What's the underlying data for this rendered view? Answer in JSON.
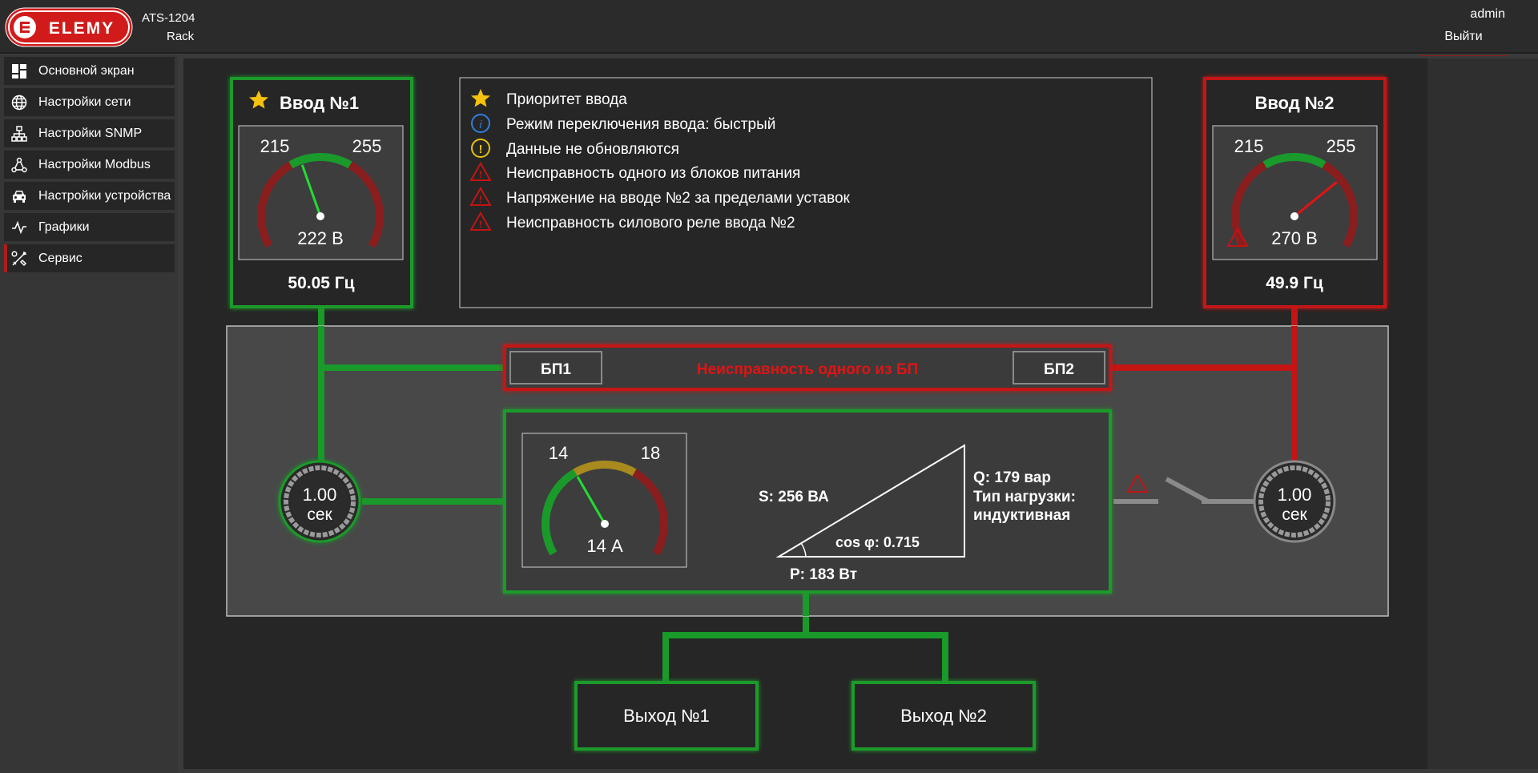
{
  "header": {
    "logo_text": "ELEMY",
    "device_model": "ATS-1204",
    "device_type": "Rack",
    "user": "admin",
    "logout_label": "Выйти"
  },
  "sidebar": {
    "items": [
      {
        "label": "Основной экран",
        "icon": "dashboard-icon",
        "active": false
      },
      {
        "label": "Настройки сети",
        "icon": "globe-icon",
        "active": false
      },
      {
        "label": "Настройки SNMP",
        "icon": "network-tree-icon",
        "active": false
      },
      {
        "label": "Настройки Modbus",
        "icon": "nodes-icon",
        "active": false
      },
      {
        "label": "Настройки устройства",
        "icon": "car-icon",
        "active": false
      },
      {
        "label": "Графики",
        "icon": "pulse-icon",
        "active": false
      },
      {
        "label": "Сервис",
        "icon": "tools-icon",
        "active": true
      }
    ]
  },
  "input1": {
    "title": "Ввод №1",
    "priority": true,
    "gauge_min_label": "215",
    "gauge_max_label": "255",
    "voltage": "222 В",
    "voltage_value": 222,
    "frequency": "50.05 Гц",
    "status_color": "#1a9a2a"
  },
  "input2": {
    "title": "Ввод №2",
    "gauge_min_label": "215",
    "gauge_max_label": "255",
    "voltage": "270 В",
    "voltage_value": 270,
    "frequency": "49.9 Гц",
    "status_color": "#c41414",
    "warning": true
  },
  "events": [
    {
      "icon": "star-icon",
      "text": "Приоритет ввода"
    },
    {
      "icon": "info-icon",
      "text": "Режим переключения ввода: быстрый"
    },
    {
      "icon": "exclamation-circle-icon",
      "text": "Данные не обновляются"
    },
    {
      "icon": "warning-triangle-icon",
      "text": "Неисправность одного из блоков питания"
    },
    {
      "icon": "warning-triangle-icon",
      "text": "Напряжение на вводе №2 за пределами уставок"
    },
    {
      "icon": "warning-triangle-icon",
      "text": "Неисправность силового реле ввода №2"
    }
  ],
  "power_supply": {
    "bp1_label": "БП1",
    "bp2_label": "БП2",
    "fault_text": "Неисправность одного из БП"
  },
  "load": {
    "gauge_min_label": "14",
    "gauge_max_label": "18",
    "current": "14 А",
    "current_value": 14,
    "s_label": "S: 256 ВА",
    "q_label": "Q: 179 вар",
    "p_label": "P: 183 Вт",
    "cos_label": "cos φ: 0.715",
    "load_type_label": "Тип нагрузки:",
    "load_type_value": "индуктивная"
  },
  "timer1": {
    "value": "1.00",
    "unit": "сек"
  },
  "timer2": {
    "value": "1.00",
    "unit": "сек"
  },
  "outputs": [
    {
      "label": "Выход №1"
    },
    {
      "label": "Выход №2"
    }
  ],
  "colors": {
    "green": "#1a9a2a",
    "bright_green": "#22cc33",
    "red": "#c41414",
    "gray": "#888888"
  }
}
